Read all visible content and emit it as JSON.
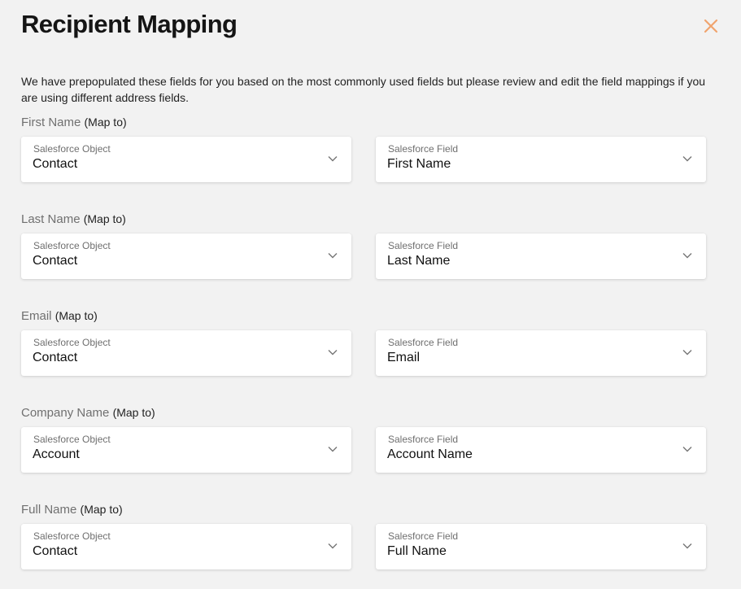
{
  "title": "Recipient Mapping",
  "intro": "We have prepopulated these fields for you based on the most commonly used fields but please review and edit the field mappings if you are using different address fields.",
  "accent_color": "#f0a46e",
  "close_icon": "close-icon",
  "map_to_text": "(Map to)",
  "object_label": "Salesforce Object",
  "field_label": "Salesforce Field",
  "sections": [
    {
      "label": "First Name",
      "object": "Contact",
      "field": "First Name"
    },
    {
      "label": "Last Name",
      "object": "Contact",
      "field": "Last Name"
    },
    {
      "label": "Email",
      "object": "Contact",
      "field": "Email"
    },
    {
      "label": "Company Name",
      "object": "Account",
      "field": "Account Name"
    },
    {
      "label": "Full Name",
      "object": "Contact",
      "field": "Full Name"
    }
  ]
}
